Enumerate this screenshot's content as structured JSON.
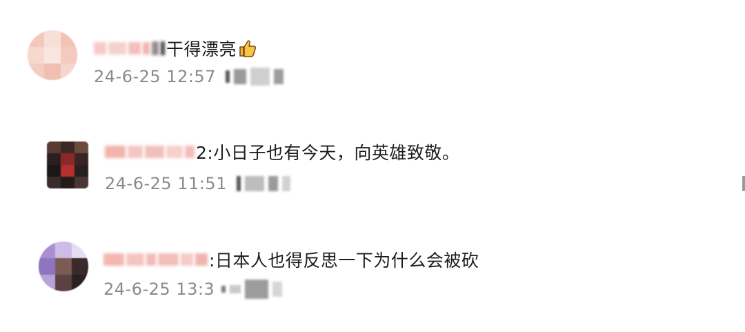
{
  "comments": [
    {
      "text_fragment": "干得漂亮",
      "emoji": "thumbs-up-icon",
      "timestamp": "24-6-25 12:57"
    },
    {
      "text_fragment": "2:小日子也有今天，向英雄致敬。",
      "timestamp": "24-6-25 11:51"
    },
    {
      "text_fragment": ":日本人也得反思一下为什么会被砍",
      "timestamp": "24-6-25 13:3"
    }
  ],
  "colors": {
    "text": "#1d1d1d",
    "meta": "#8a8a8a",
    "name_blur": "#f2b8b4",
    "thumb": "#f2b33a"
  }
}
